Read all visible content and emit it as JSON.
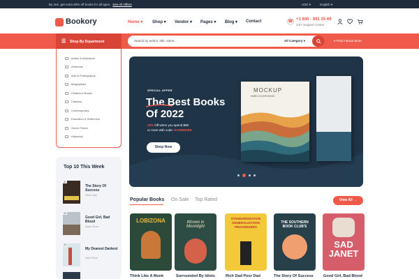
{
  "topbar": {
    "promo": "By one, get extra 50% off books for all ages.",
    "promo_link": "See All Offers",
    "currency": "USD",
    "language": "English"
  },
  "brand": {
    "name": "Bookory",
    "accent": "#ef5a4a",
    "dark": "#1f2b3a"
  },
  "nav": [
    {
      "label": "Home",
      "active": true
    },
    {
      "label": "Shop"
    },
    {
      "label": "Vendor"
    },
    {
      "label": "Pages"
    },
    {
      "label": "Blog"
    },
    {
      "label": "Contact"
    }
  ],
  "contact": {
    "phone": "+1 840 - 841 25 69",
    "support": "24/7 Support Center"
  },
  "header_icons": [
    "user-icon",
    "heart-icon",
    "cart-icon"
  ],
  "department": {
    "label": "Shop By Department"
  },
  "search": {
    "placeholder": "Search by author, title, name...",
    "category": "All Category"
  },
  "track": {
    "label": "Find A Book Store"
  },
  "categories": [
    "Action & Adventure",
    "Americas",
    "Arts & Photography",
    "Biographies",
    "Children's Books",
    "Classics",
    "Contemporary",
    "Education & Reference",
    "Genre Fiction",
    "Historical"
  ],
  "hero": {
    "tag": "SPECIAL OFFER",
    "title_line1": "The Best Books",
    "title_line2": "Of 2022",
    "sub_pct": "10%",
    "sub_rest": " Off when you spend $99",
    "sub_line2_pre": "or more with code: ",
    "code": "SAVEMORE",
    "button": "Shop Now",
    "book_label1": "MOCKUP",
    "book_label2": "HARD COVER BOOK"
  },
  "top10": {
    "title": "Top 10 This Week",
    "items": [
      {
        "num": "01",
        "title": "The Story Of Success",
        "author": "Helen Way"
      },
      {
        "num": "02",
        "title": "Good Girl, Bad Blood",
        "author": "Adam Strom"
      },
      {
        "num": "03",
        "title": "My Dearest Darkest",
        "author": "Mark Prime"
      }
    ]
  },
  "popular": {
    "tabs": [
      "Popular Books",
      "On Sale",
      "Top Rated"
    ],
    "view_all": "View All",
    "books": [
      {
        "title": "Think Like A Monk",
        "cover_text": "LOBIZONA"
      },
      {
        "title": "Surrounded By Idiots",
        "cover_text": "Woven in Moonlight"
      },
      {
        "title": "Rich Dad Poor Dad",
        "cover_text": "STANDARDIZATION GENERALIZATION PROCEDURES"
      },
      {
        "title": "The Story Of Success",
        "cover_text": "THE SOUTHERN BOOK CLUB'S"
      },
      {
        "title": "Good Girl, Bad Blood",
        "cover_text": "SAD JANET"
      }
    ]
  }
}
